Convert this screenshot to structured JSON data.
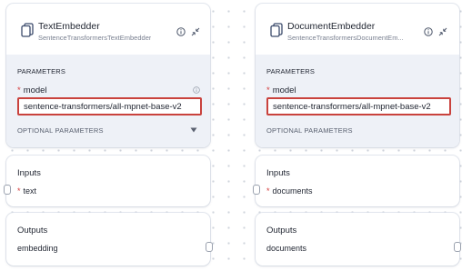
{
  "nodes": [
    {
      "title": "TextEmbedder",
      "subtitle": "SentenceTransformersTextEmbedder",
      "parameters_label": "PARAMETERS",
      "model_label": "model",
      "model_required": "*",
      "model_value": "sentence-transformers/all-mpnet-base-v2",
      "optional_label": "OPTIONAL PARAMETERS",
      "inputs_title": "Inputs",
      "input_port": "text",
      "input_required": "*",
      "outputs_title": "Outputs",
      "output_port": "embedding"
    },
    {
      "title": "DocumentEmbedder",
      "subtitle": "SentenceTransformersDocumentEm...",
      "parameters_label": "PARAMETERS",
      "model_label": "model",
      "model_required": "*",
      "model_value": "sentence-transformers/all-mpnet-base-v2",
      "optional_label": "OPTIONAL PARAMETERS",
      "inputs_title": "Inputs",
      "input_port": "documents",
      "input_required": "*",
      "outputs_title": "Outputs",
      "output_port": "documents"
    }
  ],
  "icons": {
    "component": "component-icon",
    "info": "info-icon",
    "collapse": "collapse-icon",
    "caret": "chevron-down-icon"
  },
  "colors": {
    "highlight": "#c9423d",
    "required": "#d43a3a",
    "params_bg": "#eef1f7"
  }
}
